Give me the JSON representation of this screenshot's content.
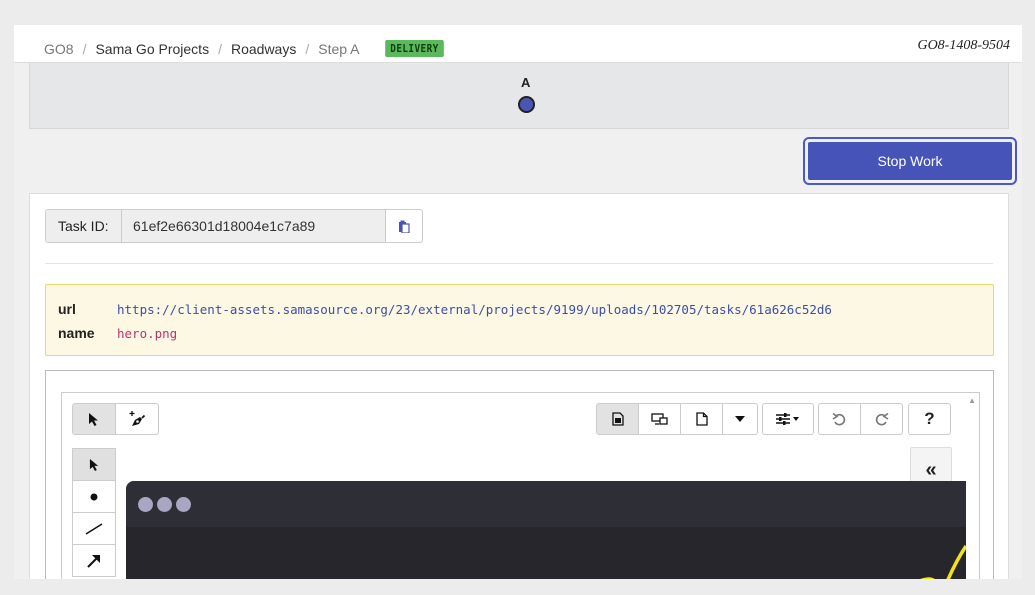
{
  "breadcrumb": {
    "items": [
      "GO8",
      "Sama Go Projects",
      "Roadways",
      "Step A"
    ],
    "separator": "/",
    "badge": "DELIVERY"
  },
  "task_code": "GO8-1408-9504",
  "steps": [
    {
      "label": "A",
      "status": "current"
    }
  ],
  "stop_button": {
    "label": "Stop Work"
  },
  "task": {
    "id_label": "Task ID:",
    "id_value": "61ef2e66301d18004e1c7a89",
    "copy_icon": "clipboard-icon"
  },
  "metadata": {
    "url_key": "url",
    "url_value": "https://client-assets.samasource.org/23/external/projects/9199/uploads/102705/tasks/61a626c52d6",
    "name_key": "name",
    "name_value": "hero.png"
  },
  "toolbar": {
    "left_tools": [
      "pointer-icon",
      "magic-pen-icon"
    ],
    "right_tools": [
      "image-doc-icon",
      "screens-icon",
      "blank-doc-icon",
      "caret-down-icon",
      "sliders-icon",
      "undo-icon",
      "redo-icon",
      "help-icon"
    ],
    "help_label": "?"
  },
  "side_tools": [
    "pointer-icon",
    "point-icon",
    "line-icon",
    "arrow-icon"
  ],
  "collapse_label": "«",
  "colors": {
    "accent": "#4654b8",
    "badge": "#5cb85c",
    "meta_bg": "#fcf8e3",
    "canvas_bg": "#26262c",
    "annotation": "#f2e316"
  }
}
